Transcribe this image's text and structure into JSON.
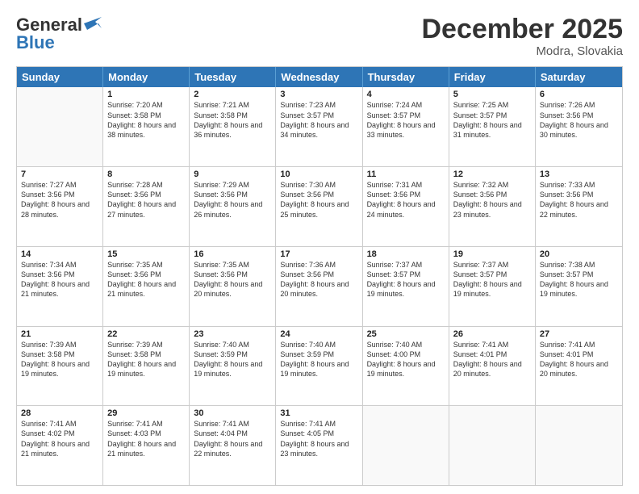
{
  "header": {
    "logo_general": "General",
    "logo_blue": "Blue",
    "month_title": "December 2025",
    "location": "Modra, Slovakia"
  },
  "days_of_week": [
    "Sunday",
    "Monday",
    "Tuesday",
    "Wednesday",
    "Thursday",
    "Friday",
    "Saturday"
  ],
  "weeks": [
    [
      {
        "day": "",
        "sunrise": "",
        "sunset": "",
        "daylight": ""
      },
      {
        "day": "1",
        "sunrise": "Sunrise: 7:20 AM",
        "sunset": "Sunset: 3:58 PM",
        "daylight": "Daylight: 8 hours and 38 minutes."
      },
      {
        "day": "2",
        "sunrise": "Sunrise: 7:21 AM",
        "sunset": "Sunset: 3:58 PM",
        "daylight": "Daylight: 8 hours and 36 minutes."
      },
      {
        "day": "3",
        "sunrise": "Sunrise: 7:23 AM",
        "sunset": "Sunset: 3:57 PM",
        "daylight": "Daylight: 8 hours and 34 minutes."
      },
      {
        "day": "4",
        "sunrise": "Sunrise: 7:24 AM",
        "sunset": "Sunset: 3:57 PM",
        "daylight": "Daylight: 8 hours and 33 minutes."
      },
      {
        "day": "5",
        "sunrise": "Sunrise: 7:25 AM",
        "sunset": "Sunset: 3:57 PM",
        "daylight": "Daylight: 8 hours and 31 minutes."
      },
      {
        "day": "6",
        "sunrise": "Sunrise: 7:26 AM",
        "sunset": "Sunset: 3:56 PM",
        "daylight": "Daylight: 8 hours and 30 minutes."
      }
    ],
    [
      {
        "day": "7",
        "sunrise": "Sunrise: 7:27 AM",
        "sunset": "Sunset: 3:56 PM",
        "daylight": "Daylight: 8 hours and 28 minutes."
      },
      {
        "day": "8",
        "sunrise": "Sunrise: 7:28 AM",
        "sunset": "Sunset: 3:56 PM",
        "daylight": "Daylight: 8 hours and 27 minutes."
      },
      {
        "day": "9",
        "sunrise": "Sunrise: 7:29 AM",
        "sunset": "Sunset: 3:56 PM",
        "daylight": "Daylight: 8 hours and 26 minutes."
      },
      {
        "day": "10",
        "sunrise": "Sunrise: 7:30 AM",
        "sunset": "Sunset: 3:56 PM",
        "daylight": "Daylight: 8 hours and 25 minutes."
      },
      {
        "day": "11",
        "sunrise": "Sunrise: 7:31 AM",
        "sunset": "Sunset: 3:56 PM",
        "daylight": "Daylight: 8 hours and 24 minutes."
      },
      {
        "day": "12",
        "sunrise": "Sunrise: 7:32 AM",
        "sunset": "Sunset: 3:56 PM",
        "daylight": "Daylight: 8 hours and 23 minutes."
      },
      {
        "day": "13",
        "sunrise": "Sunrise: 7:33 AM",
        "sunset": "Sunset: 3:56 PM",
        "daylight": "Daylight: 8 hours and 22 minutes."
      }
    ],
    [
      {
        "day": "14",
        "sunrise": "Sunrise: 7:34 AM",
        "sunset": "Sunset: 3:56 PM",
        "daylight": "Daylight: 8 hours and 21 minutes."
      },
      {
        "day": "15",
        "sunrise": "Sunrise: 7:35 AM",
        "sunset": "Sunset: 3:56 PM",
        "daylight": "Daylight: 8 hours and 21 minutes."
      },
      {
        "day": "16",
        "sunrise": "Sunrise: 7:35 AM",
        "sunset": "Sunset: 3:56 PM",
        "daylight": "Daylight: 8 hours and 20 minutes."
      },
      {
        "day": "17",
        "sunrise": "Sunrise: 7:36 AM",
        "sunset": "Sunset: 3:56 PM",
        "daylight": "Daylight: 8 hours and 20 minutes."
      },
      {
        "day": "18",
        "sunrise": "Sunrise: 7:37 AM",
        "sunset": "Sunset: 3:57 PM",
        "daylight": "Daylight: 8 hours and 19 minutes."
      },
      {
        "day": "19",
        "sunrise": "Sunrise: 7:37 AM",
        "sunset": "Sunset: 3:57 PM",
        "daylight": "Daylight: 8 hours and 19 minutes."
      },
      {
        "day": "20",
        "sunrise": "Sunrise: 7:38 AM",
        "sunset": "Sunset: 3:57 PM",
        "daylight": "Daylight: 8 hours and 19 minutes."
      }
    ],
    [
      {
        "day": "21",
        "sunrise": "Sunrise: 7:39 AM",
        "sunset": "Sunset: 3:58 PM",
        "daylight": "Daylight: 8 hours and 19 minutes."
      },
      {
        "day": "22",
        "sunrise": "Sunrise: 7:39 AM",
        "sunset": "Sunset: 3:58 PM",
        "daylight": "Daylight: 8 hours and 19 minutes."
      },
      {
        "day": "23",
        "sunrise": "Sunrise: 7:40 AM",
        "sunset": "Sunset: 3:59 PM",
        "daylight": "Daylight: 8 hours and 19 minutes."
      },
      {
        "day": "24",
        "sunrise": "Sunrise: 7:40 AM",
        "sunset": "Sunset: 3:59 PM",
        "daylight": "Daylight: 8 hours and 19 minutes."
      },
      {
        "day": "25",
        "sunrise": "Sunrise: 7:40 AM",
        "sunset": "Sunset: 4:00 PM",
        "daylight": "Daylight: 8 hours and 19 minutes."
      },
      {
        "day": "26",
        "sunrise": "Sunrise: 7:41 AM",
        "sunset": "Sunset: 4:01 PM",
        "daylight": "Daylight: 8 hours and 20 minutes."
      },
      {
        "day": "27",
        "sunrise": "Sunrise: 7:41 AM",
        "sunset": "Sunset: 4:01 PM",
        "daylight": "Daylight: 8 hours and 20 minutes."
      }
    ],
    [
      {
        "day": "28",
        "sunrise": "Sunrise: 7:41 AM",
        "sunset": "Sunset: 4:02 PM",
        "daylight": "Daylight: 8 hours and 21 minutes."
      },
      {
        "day": "29",
        "sunrise": "Sunrise: 7:41 AM",
        "sunset": "Sunset: 4:03 PM",
        "daylight": "Daylight: 8 hours and 21 minutes."
      },
      {
        "day": "30",
        "sunrise": "Sunrise: 7:41 AM",
        "sunset": "Sunset: 4:04 PM",
        "daylight": "Daylight: 8 hours and 22 minutes."
      },
      {
        "day": "31",
        "sunrise": "Sunrise: 7:41 AM",
        "sunset": "Sunset: 4:05 PM",
        "daylight": "Daylight: 8 hours and 23 minutes."
      },
      {
        "day": "",
        "sunrise": "",
        "sunset": "",
        "daylight": ""
      },
      {
        "day": "",
        "sunrise": "",
        "sunset": "",
        "daylight": ""
      },
      {
        "day": "",
        "sunrise": "",
        "sunset": "",
        "daylight": ""
      }
    ]
  ]
}
